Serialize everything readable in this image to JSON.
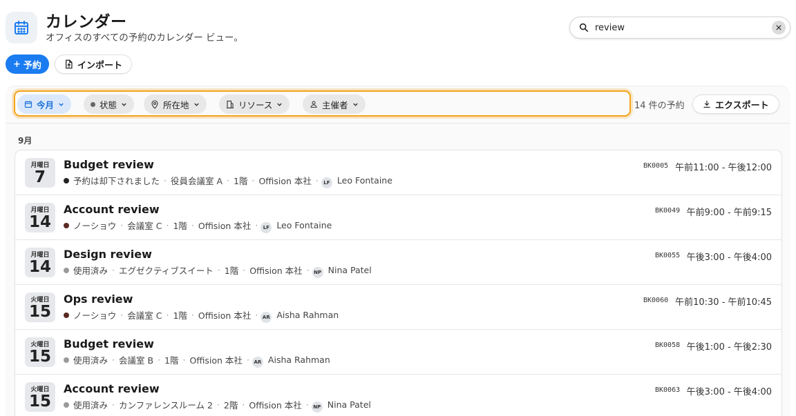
{
  "header": {
    "title": "カレンダー",
    "subtitle": "オフィスのすべての予約のカレンダー ビュー。",
    "app_icon": "calendar-icon",
    "accent": "#1a7cf0"
  },
  "search": {
    "value": "review",
    "icon": "search-icon"
  },
  "actions": {
    "reserve_label": "予約",
    "reserve_prefix": "+",
    "import_label": "インポート"
  },
  "filters": [
    {
      "label": "今月",
      "icon": "calendar-icon",
      "active": true
    },
    {
      "label": "状態",
      "icon": "dot-icon",
      "active": false
    },
    {
      "label": "所在地",
      "icon": "location-pin-icon",
      "active": false
    },
    {
      "label": "リソース",
      "icon": "building-icon",
      "active": false
    },
    {
      "label": "主催者",
      "icon": "person-icon",
      "active": false
    }
  ],
  "filter_highlight_color": "#f5a31a",
  "summary": {
    "count_text": "14 件の予約",
    "export_label": "エクスポート"
  },
  "month_label": "9月",
  "bookings": [
    {
      "dow": "月曜日",
      "day": "7",
      "title": "Budget review",
      "status": "予約は却下されました",
      "status_color": "#222222",
      "room": "役員会議室 A",
      "floor": "1階",
      "office": "Offision 本社",
      "initials": "LF",
      "organizer": "Leo Fontaine",
      "code": "BK0005",
      "time": "午前11:00 - 午後12:00"
    },
    {
      "dow": "月曜日",
      "day": "14",
      "title": "Account review",
      "status": "ノーショウ",
      "status_color": "#5a2a22",
      "room": "会議室 C",
      "floor": "1階",
      "office": "Offision 本社",
      "initials": "LF",
      "organizer": "Leo Fontaine",
      "code": "BK0049",
      "time": "午前9:00 - 午前9:15"
    },
    {
      "dow": "月曜日",
      "day": "14",
      "title": "Design review",
      "status": "使用済み",
      "status_color": "#9a9a9a",
      "room": "エグゼクティブスイート",
      "floor": "1階",
      "office": "Offision 本社",
      "initials": "NP",
      "organizer": "Nina Patel",
      "code": "BK0055",
      "time": "午後3:00 - 午後4:00"
    },
    {
      "dow": "火曜日",
      "day": "15",
      "title": "Ops review",
      "status": "ノーショウ",
      "status_color": "#5a2a22",
      "room": "会議室 C",
      "floor": "1階",
      "office": "Offision 本社",
      "initials": "AR",
      "organizer": "Aisha Rahman",
      "code": "BK0060",
      "time": "午前10:30 - 午前10:45"
    },
    {
      "dow": "火曜日",
      "day": "15",
      "title": "Budget review",
      "status": "使用済み",
      "status_color": "#9a9a9a",
      "room": "会議室 B",
      "floor": "1階",
      "office": "Offision 本社",
      "initials": "AR",
      "organizer": "Aisha Rahman",
      "code": "BK0058",
      "time": "午後1:00 - 午後2:30"
    },
    {
      "dow": "火曜日",
      "day": "15",
      "title": "Account review",
      "status": "使用済み",
      "status_color": "#9a9a9a",
      "room": "カンファレンスルーム 2",
      "floor": "2階",
      "office": "Offision 本社",
      "initials": "NP",
      "organizer": "Nina Patel",
      "code": "BK0063",
      "time": "午後3:00 - 午後4:00"
    }
  ]
}
